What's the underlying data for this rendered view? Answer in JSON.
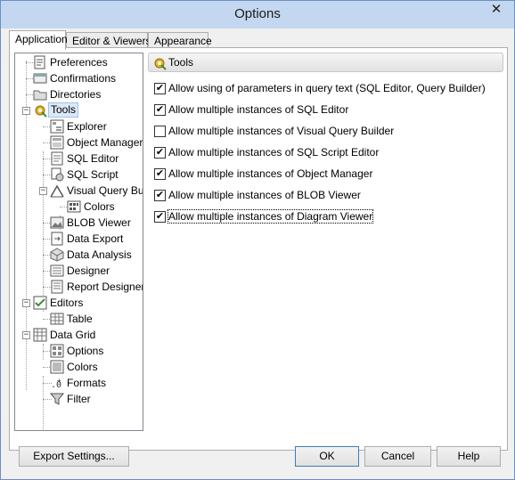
{
  "window": {
    "title": "Options",
    "close_glyph": "✕"
  },
  "tabs": [
    {
      "label": "Application",
      "active": true
    },
    {
      "label": "Editor & Viewers",
      "active": false
    },
    {
      "label": "Appearance",
      "active": false
    }
  ],
  "tree": {
    "items": [
      {
        "label": "Preferences",
        "icon": "preferences-icon"
      },
      {
        "label": "Confirmations",
        "icon": "confirmations-icon"
      },
      {
        "label": "Directories",
        "icon": "folder-icon"
      },
      {
        "label": "Tools",
        "icon": "tools-icon",
        "selected": true
      },
      {
        "label": "Explorer",
        "icon": "explorer-icon"
      },
      {
        "label": "Object Manager",
        "icon": "object-manager-icon"
      },
      {
        "label": "SQL Editor",
        "icon": "sql-editor-icon"
      },
      {
        "label": "SQL Script",
        "icon": "sql-script-icon"
      },
      {
        "label": "Visual Query Builder",
        "icon": "query-builder-icon"
      },
      {
        "label": "Colors",
        "icon": "colors-icon"
      },
      {
        "label": "BLOB Viewer",
        "icon": "blob-viewer-icon"
      },
      {
        "label": "Data Export",
        "icon": "data-export-icon"
      },
      {
        "label": "Data Analysis",
        "icon": "data-analysis-icon"
      },
      {
        "label": "Designer",
        "icon": "designer-icon"
      },
      {
        "label": "Report Designer",
        "icon": "report-designer-icon"
      },
      {
        "label": "Editors",
        "icon": "editors-icon"
      },
      {
        "label": "Table",
        "icon": "table-icon"
      },
      {
        "label": "Data Grid",
        "icon": "data-grid-icon"
      },
      {
        "label": "Options",
        "icon": "options-icon"
      },
      {
        "label": "Colors",
        "icon": "colors-icon"
      },
      {
        "label": "Formats",
        "icon": "formats-icon"
      },
      {
        "label": "Filter",
        "icon": "filter-icon"
      }
    ]
  },
  "panel": {
    "title": "Tools",
    "options": [
      {
        "label": "Allow using of parameters in query text (SQL Editor, Query Builder)",
        "checked": true
      },
      {
        "label": "Allow multiple instances of SQL Editor",
        "checked": true
      },
      {
        "label": "Allow multiple instances of Visual Query Builder",
        "checked": false
      },
      {
        "label": "Allow multiple instances of SQL Script Editor",
        "checked": true
      },
      {
        "label": "Allow multiple instances of Object Manager",
        "checked": true
      },
      {
        "label": "Allow multiple instances of BLOB Viewer",
        "checked": true
      },
      {
        "label": "Allow multiple instances of Diagram Viewer",
        "checked": true,
        "focused": true
      }
    ],
    "check_glyph": "✔"
  },
  "buttons": {
    "export": "Export Settings...",
    "ok": "OK",
    "cancel": "Cancel",
    "help": "Help"
  }
}
